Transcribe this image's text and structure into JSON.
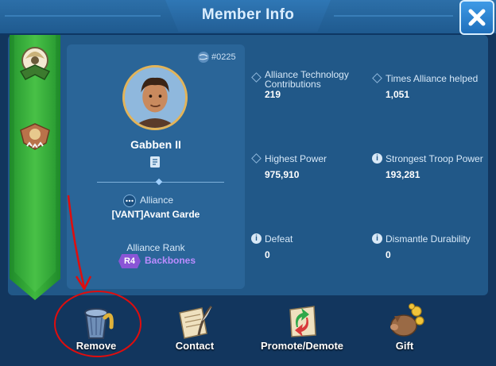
{
  "header": {
    "title": "Member Info"
  },
  "profile": {
    "id": "#0225",
    "name": "Gabben II",
    "alliance_label": "Alliance",
    "alliance_name": "[VANT]Avant Garde",
    "rank_label": "Alliance Rank",
    "rank_code": "R4",
    "rank_name": "Backbones"
  },
  "stats": [
    {
      "label_line1": "Alliance Technology",
      "label_line2": "Contributions",
      "value": "219",
      "icon": "diamond-icon"
    },
    {
      "label_line1": "Times Alliance helped",
      "label_line2": "",
      "value": "1,051",
      "icon": "diamond-icon"
    },
    {
      "label_line1": "Highest Power",
      "label_line2": "",
      "value": "975,910",
      "icon": "diamond-icon"
    },
    {
      "label_line1": "Strongest Troop Power",
      "label_line2": "",
      "value": "193,281",
      "icon": "info-icon"
    },
    {
      "label_line1": "Defeat",
      "label_line2": "",
      "value": "0",
      "icon": "info-icon"
    },
    {
      "label_line1": "Dismantle Durability",
      "label_line2": "",
      "value": "0",
      "icon": "info-icon"
    }
  ],
  "actions": [
    {
      "label": "Remove",
      "icon": "trash-bin-icon"
    },
    {
      "label": "Contact",
      "icon": "letter-quill-icon"
    },
    {
      "label": "Promote/Demote",
      "icon": "promote-demote-icon"
    },
    {
      "label": "Gift",
      "icon": "gift-pig-icon"
    }
  ],
  "colors": {
    "background": "#12365e",
    "panel": "#215888",
    "banner_green": "#3fb83e",
    "rank_purple": "#8a55d6",
    "annotation_red": "#e00d0d"
  }
}
